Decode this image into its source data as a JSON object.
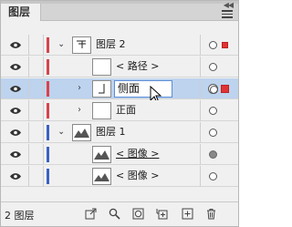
{
  "panel": {
    "tab_label": "图层",
    "collapse_glyph": "◀◀",
    "menu_icon": "hamburger-menu-icon"
  },
  "colors": {
    "layer2": "#d9434b",
    "layer1": "#3a62c4",
    "selected_row": "#bdd3ee",
    "selection_square": "#e03333"
  },
  "layers": [
    {
      "name": "图层 2",
      "kind": "layer",
      "expanded": true
    },
    {
      "name": "< 路径 >",
      "kind": "path"
    },
    {
      "name": "侧面",
      "kind": "group",
      "selected": true,
      "editing": true
    },
    {
      "name": "正面",
      "kind": "group"
    },
    {
      "name": "图层 1",
      "kind": "layer",
      "expanded": true
    },
    {
      "name": "< 图像 >",
      "kind": "image",
      "targeted": true
    },
    {
      "name": "< 图像 >",
      "kind": "image"
    }
  ],
  "footer": {
    "layer_count": "2 图层",
    "icons": [
      "export-icon",
      "search-icon",
      "clip-mask-icon",
      "new-sublayer-icon",
      "new-layer-icon",
      "delete-icon"
    ]
  }
}
